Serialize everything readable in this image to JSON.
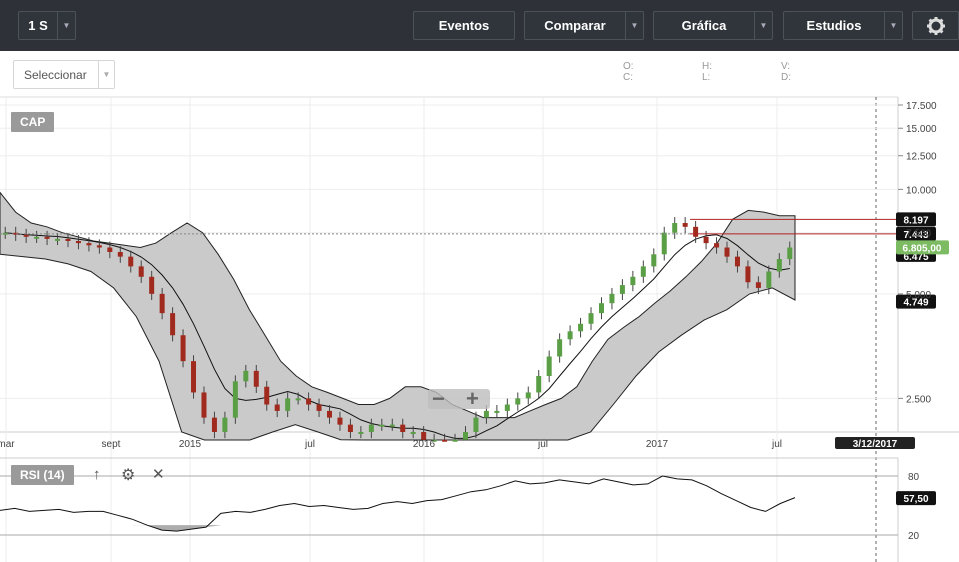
{
  "toolbar": {
    "period": "1 S",
    "events": "Eventos",
    "compare": "Comparar",
    "chart": "Gráfica",
    "studies": "Estudios"
  },
  "subbar": {
    "select_placeholder": "Seleccionar",
    "ohlc": {
      "o": "O:",
      "c": "C:",
      "h": "H:",
      "l": "L:",
      "v": "V:",
      "d": "D:"
    }
  },
  "symbol": "CAP",
  "indicator": "RSI (14)",
  "colors": {
    "up": "#5a9e45",
    "down": "#a12a1e",
    "band_fill": "#cacaca",
    "price_flag": "#7dbb63",
    "ref_line": "#b22222"
  },
  "icons": {
    "settings": "gear-icon",
    "up": "arrow-up-icon",
    "remove": "close-icon",
    "zoom_out": "minus-icon",
    "zoom_in": "plus-icon"
  },
  "chart_data": [
    {
      "type": "candlestick",
      "title": "CAP",
      "yscale": "log",
      "y_ticks": [
        "17.500",
        "15.000",
        "12.500",
        "10.000",
        "7.500",
        "5.000",
        "2.500"
      ],
      "x_ticks": [
        "mar",
        "sept",
        "2015",
        "jul",
        "2016",
        "jul",
        "2017",
        "jul"
      ],
      "flags": {
        "high_line": "8.197",
        "low_line": "7.443",
        "band_lower": "6.475",
        "last_price": "6.805,00",
        "band_low_marker": "4.749"
      },
      "crosshair_date": "3/12/2017",
      "approx_close_series": [
        7.5,
        7.4,
        7.3,
        7.3,
        7.2,
        7.2,
        7.1,
        7.0,
        6.9,
        6.8,
        6.6,
        6.4,
        6.0,
        5.6,
        5.0,
        4.4,
        3.8,
        3.2,
        2.6,
        2.2,
        2.0,
        2.2,
        2.8,
        3.0,
        2.7,
        2.4,
        2.3,
        2.5,
        2.5,
        2.4,
        2.3,
        2.2,
        2.1,
        2.0,
        2.0,
        2.1,
        2.1,
        2.1,
        2.0,
        2.0,
        1.9,
        1.9,
        1.8,
        1.9,
        2.0,
        2.2,
        2.3,
        2.3,
        2.4,
        2.5,
        2.6,
        2.9,
        3.3,
        3.7,
        3.9,
        4.1,
        4.4,
        4.7,
        5.0,
        5.3,
        5.6,
        6.0,
        6.5,
        7.5,
        8.0,
        7.8,
        7.3,
        7.0,
        6.8,
        6.4,
        6.0,
        5.4,
        5.2,
        5.8,
        6.3,
        6.8
      ],
      "bollinger": {
        "upper_approx": [
          9.8,
          8.6,
          8.0,
          7.8,
          7.5,
          7.3,
          7.1,
          7.0,
          6.9,
          6.8,
          7.0,
          7.5,
          8.0,
          7.5,
          6.5,
          5.5,
          4.5,
          3.8,
          3.2,
          2.9,
          2.7,
          2.6,
          2.5,
          2.4,
          2.4,
          2.5,
          2.7,
          2.7,
          2.6,
          2.4,
          2.3,
          2.2,
          2.2,
          2.2,
          2.3,
          2.4,
          2.5,
          2.7,
          3.2,
          3.7,
          4.0,
          4.3,
          4.7,
          5.1,
          5.6,
          6.2,
          7.0,
          8.2,
          8.7,
          8.6,
          8.4,
          8.4
        ],
        "lower_approx": [
          6.5,
          6.4,
          6.3,
          6.1,
          5.8,
          5.2,
          4.3,
          3.2,
          2.0,
          1.3,
          1.4,
          1.7,
          2.0,
          2.1,
          2.0,
          1.9,
          1.8,
          1.7,
          1.6,
          1.6,
          1.6,
          1.5,
          1.4,
          1.3,
          1.4,
          1.7,
          2.0,
          2.4,
          2.9,
          3.4,
          3.8,
          4.2,
          4.5,
          5.0,
          5.2,
          4.8
        ]
      }
    },
    {
      "type": "line",
      "title": "RSI (14)",
      "y_ticks": [
        "80",
        "20"
      ],
      "last_value": "57,50",
      "rsi_approx": [
        45,
        47,
        44,
        45,
        46,
        43,
        44,
        44,
        40,
        36,
        30,
        25,
        24,
        26,
        28,
        42,
        44,
        43,
        46,
        50,
        52,
        49,
        50,
        48,
        46,
        47,
        52,
        54,
        52,
        55,
        56,
        60,
        64,
        66,
        70,
        75,
        72,
        73,
        76,
        74,
        72,
        77,
        74,
        71,
        72,
        80,
        77,
        76,
        70,
        62,
        55,
        48,
        44,
        52,
        58
      ]
    }
  ]
}
